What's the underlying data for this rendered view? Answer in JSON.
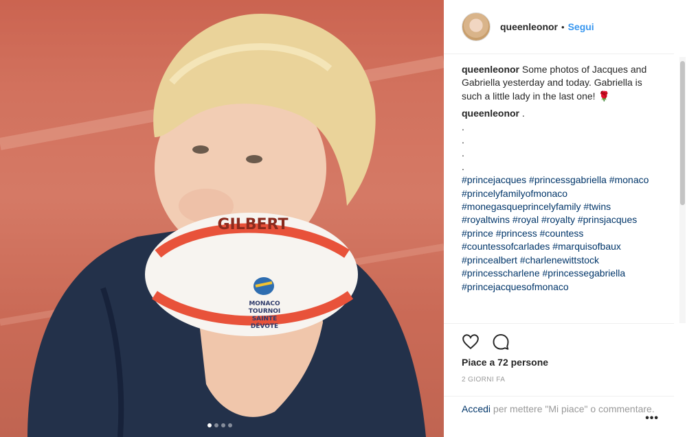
{
  "post": {
    "username": "queenleonor",
    "separator": "•",
    "follow_label": "Segui",
    "caption_user": "queenleonor",
    "caption_text": " Some photos of Jacques and Gabriella yesterday and today. Gabriella is such a little lady in the last one! 🌹",
    "comment2_user": "queenleonor",
    "comment2_text": " .",
    "dots_lines": [
      ".",
      ".",
      ".",
      "."
    ],
    "hashtags": "#princejacques #princessgabriella #monaco #princelyfamilyofmonaco #monegasqueprincelyfamily #twins #royaltwins #royal #royalty #prinsjacques #prince #princess #countess #countessofcarlades #marquisofbaux #princealbert #charlenewittstock #princesscharlene #princessegabriella #princejacquesofmonaco",
    "likes": "Piace a 72 persone",
    "time": "2 GIORNI FA",
    "login_link": "Accedi",
    "login_rest": " per mettere \"Mi piace\" o commentare.",
    "more_label": "•••"
  },
  "photo": {
    "ball_text_top": "GILBERT",
    "ball_text_1": "MONACO",
    "ball_text_2": "TOURNOI",
    "ball_text_3": "SAINTE",
    "ball_text_4": "DÉVOTE",
    "carousel_count": 4,
    "carousel_active": 0
  },
  "icons": [
    "heart-icon",
    "comment-icon"
  ],
  "colors": {
    "link": "#003569",
    "follow": "#3897f0",
    "muted": "#999999"
  }
}
